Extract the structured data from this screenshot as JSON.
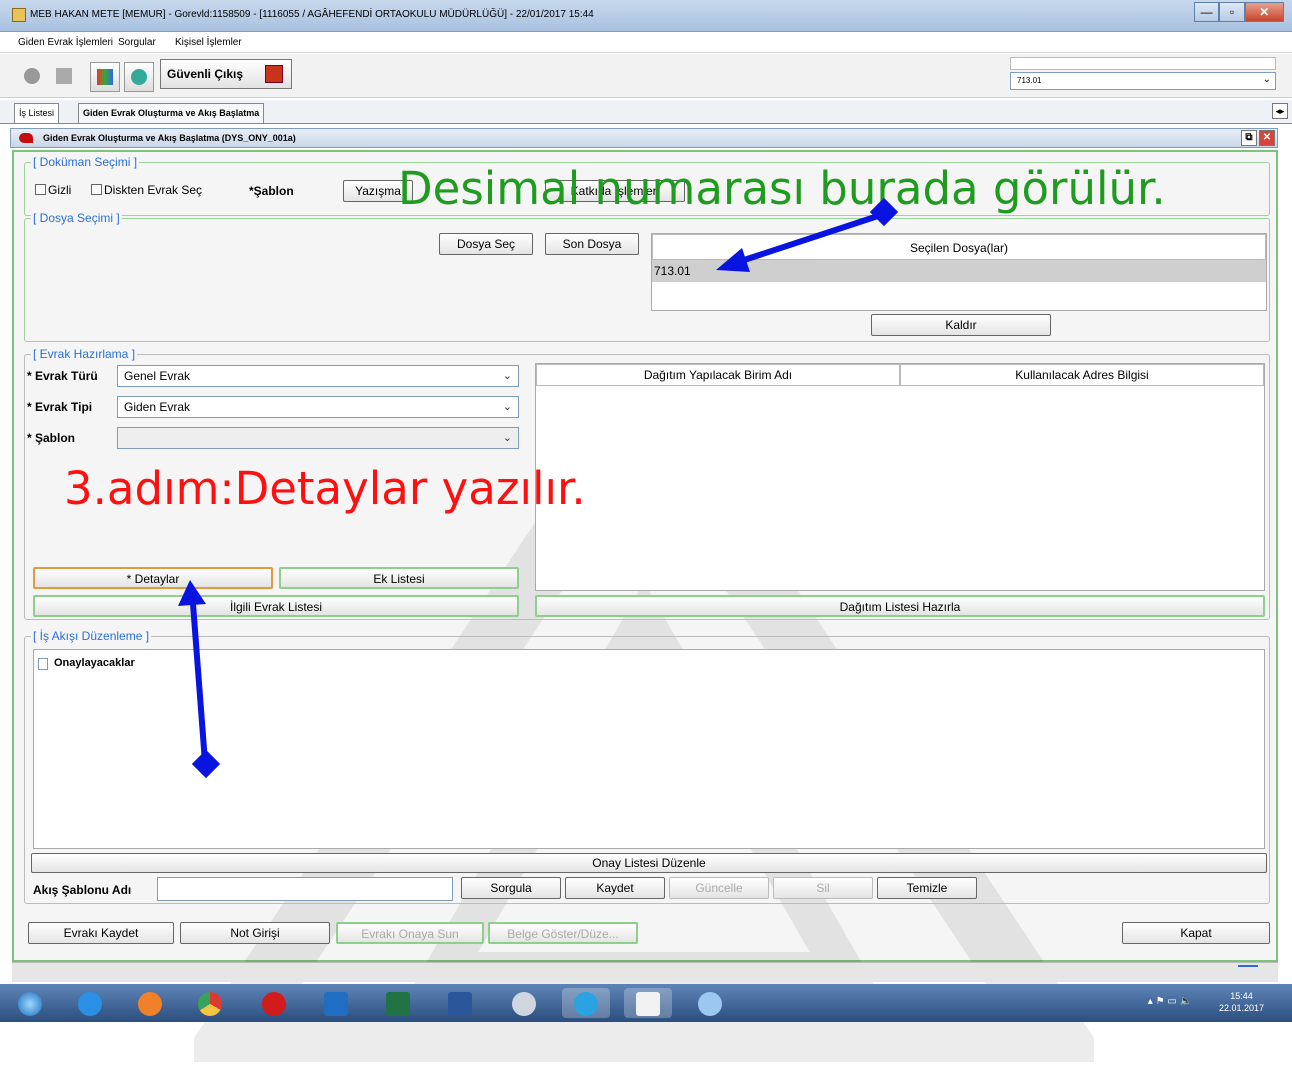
{
  "window": {
    "title": "MEB  HAKAN METE  [MEMUR] - Gorevld:1158509 - [1116055 / AGÂHEFENDİ ORTAOKULU MÜDÜRLÜĞÜ] - 22/01/2017 15:44",
    "min": "—",
    "max": "▫",
    "close": "✕"
  },
  "menu": {
    "items": [
      "Giden Evrak İşlemleri",
      "Sorgular",
      "Kişisel İşlemler"
    ]
  },
  "toolbar": {
    "exit_label": "Güvenli Çıkış",
    "combo_value": "713.01"
  },
  "tabs": {
    "items": [
      "İş Listesi",
      "Giden Evrak Oluşturma ve Akış Başlatma"
    ],
    "scroll": "◂▸"
  },
  "frame": {
    "title": "Giden Evrak Oluşturma ve Akış Başlatma (DYS_ONY_001a)",
    "restore": "⧉",
    "close": "✕"
  },
  "doc_section": {
    "legend": "[ Doküman Seçimi ]",
    "gizli": "Gizli",
    "disk": "Diskten Evrak Seç",
    "sablon_label": "*Şablon",
    "yazisma_btn": "Yazışma",
    "katkida_btn": "Katkıda İşlemleri"
  },
  "file_section": {
    "legend": "[ Dosya Seçimi ]",
    "dosya_sec": "Dosya Seç",
    "son_dosya": "Son Dosya",
    "header": "Seçilen Dosya(lar)",
    "selected": "713.01",
    "kaldir": "Kaldır"
  },
  "prep_section": {
    "legend": "[ Evrak Hazırlama ]",
    "tur_label": "* Evrak Türü",
    "tur_value": "Genel Evrak",
    "tip_label": "* Evrak Tipi",
    "tip_value": "Giden Evrak",
    "sablon_label": "* Şablon",
    "sablon_value": "",
    "detaylar": "* Detaylar",
    "ek_listesi": "Ek Listesi",
    "ilgili": "İlgili Evrak Listesi",
    "col1": "Dağıtım Yapılacak Birim Adı",
    "col2": "Kullanılacak Adres Bilgisi",
    "dagitim_btn": "Dağıtım Listesi Hazırla"
  },
  "flow_section": {
    "legend": "[ İş Akışı Düzenleme ]",
    "tree_root": "Onaylayacaklar",
    "onay_btn": "Onay Listesi Düzenle",
    "sablon_adi": "Akış Şablonu Adı",
    "sorgula": "Sorgula",
    "kaydet": "Kaydet",
    "guncelle": "Güncelle",
    "sil": "Sil",
    "temizle": "Temizle"
  },
  "bottom": {
    "evraki_kaydet": "Evrakı Kaydet",
    "not_girisi": "Not Girişi",
    "onaya_sun": "Evrakı Onaya Sun",
    "belge_goster": "Belge Göster/Düze...",
    "kapat": "Kapat"
  },
  "annotations": {
    "green": "Desimal numarası burada görülür.",
    "red": "3.adım:Detaylar yazılır."
  },
  "taskbar": {
    "time": "15:44",
    "date": "22.01.2017",
    "tray": "▴  ⚑  ▭  🔈"
  },
  "colors": {
    "annotation_green": "#1f9b1f",
    "annotation_red": "#ff1010",
    "arrow": "#0a14e0",
    "panel_border": "#7cc47c"
  }
}
